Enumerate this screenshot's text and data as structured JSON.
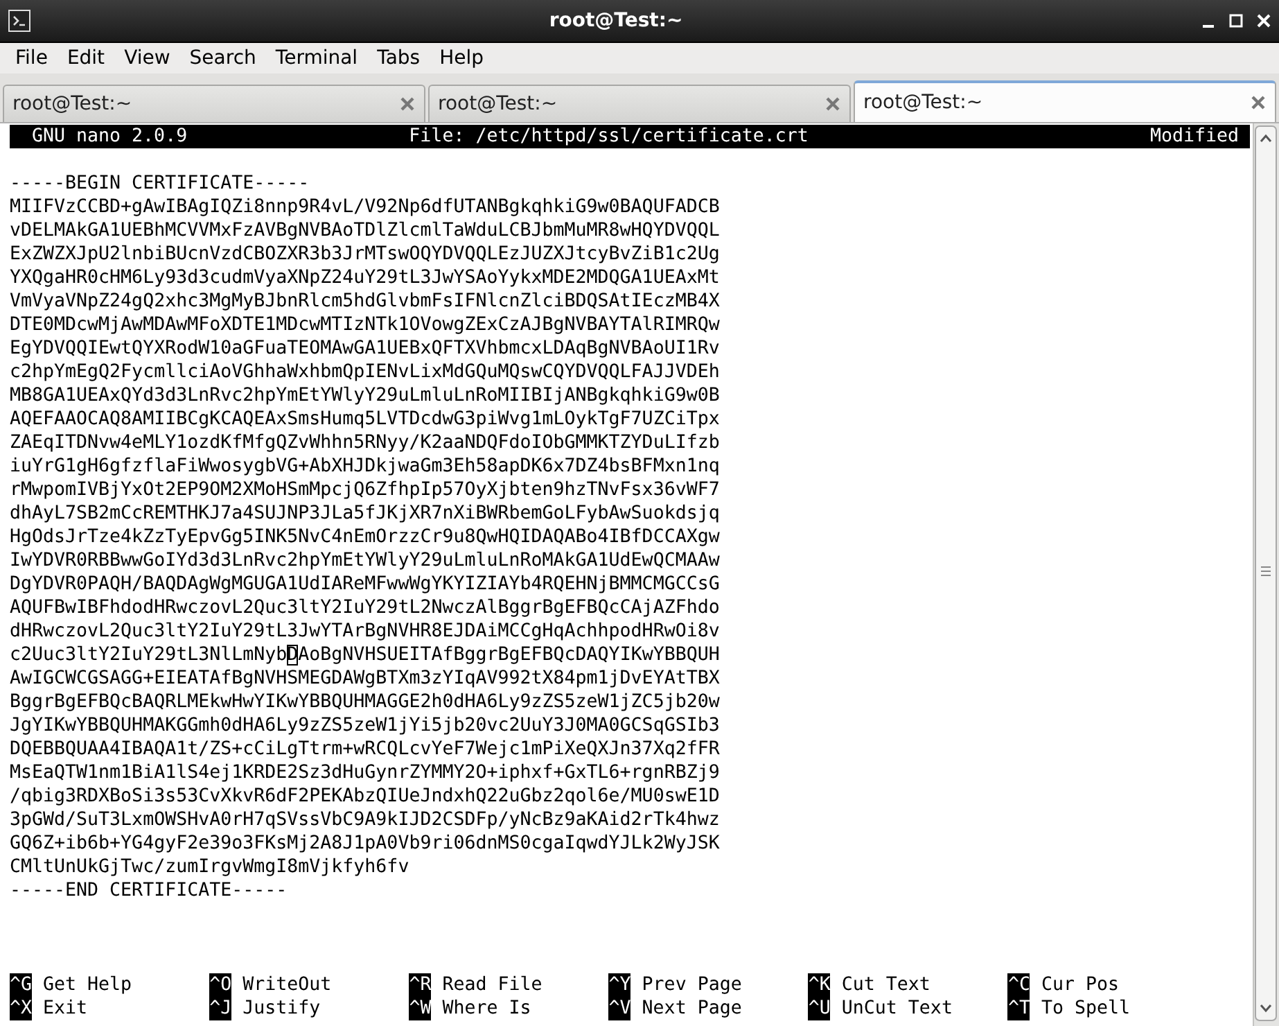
{
  "window": {
    "title": "root@Test:~"
  },
  "menu": [
    "File",
    "Edit",
    "View",
    "Search",
    "Terminal",
    "Tabs",
    "Help"
  ],
  "tabs": [
    {
      "label": "root@Test:~",
      "selected": false
    },
    {
      "label": "root@Test:~",
      "selected": false
    },
    {
      "label": "root@Test:~",
      "selected": true
    }
  ],
  "nano_header": {
    "version": "GNU nano 2.0.9",
    "file": "File: /etc/httpd/ssl/certificate.crt",
    "status": "Modified"
  },
  "editor": {
    "lines": [
      {
        "kind": "plain",
        "text": "-----BEGIN CERTIFICATE-----"
      },
      {
        "kind": "plain",
        "text": "MIIFVzCCBD+gAwIBAgIQZi8nnp9R4vL/V92Np6dfUTANBgkqhkiG9w0BAQUFADCB"
      },
      {
        "kind": "plain",
        "text": "vDELMAkGA1UEBhMCVVMxFzAVBgNVBAoTDlZlcmlTaWduLCBJbmMuMR8wHQYDVQQL"
      },
      {
        "kind": "plain",
        "text": "ExZWZXJpU2lnbiBUcnVzdCBOZXR3b3JrMTswOQYDVQQLEzJUZXJtcyBvZiB1c2Ug"
      },
      {
        "kind": "plain",
        "text": "YXQgaHR0cHM6Ly93d3cudmVyaXNpZ24uY29tL3JwYSAoYykxMDE2MDQGA1UEAxMt"
      },
      {
        "kind": "plain",
        "text": "VmVyaVNpZ24gQ2xhc3MgMyBJbnRlcm5hdGlvbmFsIFNlcnZlciBDQSAtIEczMB4X"
      },
      {
        "kind": "plain",
        "text": "DTE0MDcwMjAwMDAwMFoXDTE1MDcwMTIzNTk1OVowgZExCzAJBgNVBAYTAlRIMRQw"
      },
      {
        "kind": "plain",
        "text": "EgYDVQQIEwtQYXRodW10aGFuaTEOMAwGA1UEBxQFTXVhbmcxLDAqBgNVBAoUI1Rv"
      },
      {
        "kind": "plain",
        "text": "c2hpYmEgQ2FycmllciAoVGhhaWxhbmQpIENvLixMdGQuMQswCQYDVQQLFAJJVDEh"
      },
      {
        "kind": "plain",
        "text": "MB8GA1UEAxQYd3d3LnRvc2hpYmEtYWlyY29uLmluLnRoMIIBIjANBgkqhkiG9w0B"
      },
      {
        "kind": "plain",
        "text": "AQEFAAOCAQ8AMIIBCgKCAQEAxSmsHumq5LVTDcdwG3piWvg1mLOykTgF7UZCiTpx"
      },
      {
        "kind": "plain",
        "text": "ZAEqITDNvw4eMLY1ozdKfMfgQZvWhhn5RNyy/K2aaNDQFdoIObGMMKTZYDuLIfzb"
      },
      {
        "kind": "plain",
        "text": "iuYrG1gH6gfzflaFiWwosygbVG+AbXHJDkjwaGm3Eh58apDK6x7DZ4bsBFMxn1nq"
      },
      {
        "kind": "plain",
        "text": "rMwpomIVBjYxOt2EP9OM2XMoHSmMpcjQ6ZfhpIp57OyXjbten9hzTNvFsx36vWF7"
      },
      {
        "kind": "plain",
        "text": "dhAyL7SB2mCcREMTHKJ7a4SUJNP3JLa5fJKjXR7nXiBWRbemGoLFybAwSuokdsjq"
      },
      {
        "kind": "plain",
        "text": "HgOdsJrTze4kZzTyEpvGg5INK5NvC4nEmOrzzCr9u8QwHQIDAQABo4IBfDCCAXgw"
      },
      {
        "kind": "plain",
        "text": "IwYDVR0RBBwwGoIYd3d3LnRvc2hpYmEtYWlyY29uLmluLnRoMAkGA1UdEwQCMAAw"
      },
      {
        "kind": "plain",
        "text": "DgYDVR0PAQH/BAQDAgWgMGUGA1UdIAReMFwwWgYKYIZIAYb4RQEHNjBMMCMGCCsG"
      },
      {
        "kind": "plain",
        "text": "AQUFBwIBFhdodHRwczovL2Quc3ltY2IuY29tL2NwczAlBggrBgEFBQcCAjAZFhdo"
      },
      {
        "kind": "plain",
        "text": "dHRwczovL2Quc3ltY2IuY29tL3JwYTArBgNVHR8EJDAiMCCgHqAchhpodHRwOi8v"
      },
      {
        "kind": "cursor",
        "before": "c2Uuc3ltY2IuY29tL3NlLmNyb",
        "at_cursor": "D",
        "after": "AoBgNVHSUEITAfBggrBgEFBQcDAQYIKwYBBQUH"
      },
      {
        "kind": "plain",
        "text": "AwIGCWCGSAGG+EIEATAfBgNVHSMEGDAWgBTXm3zYIqAV992tX84pm1jDvEYAtTBX"
      },
      {
        "kind": "plain",
        "text": "BggrBgEFBQcBAQRLMEkwHwYIKwYBBQUHMAGGE2h0dHA6Ly9zZS5zeW1jZC5jb20w"
      },
      {
        "kind": "plain",
        "text": "JgYIKwYBBQUHMAKGGmh0dHA6Ly9zZS5zeW1jYi5jb20vc2UuY3J0MA0GCSqGSIb3"
      },
      {
        "kind": "plain",
        "text": "DQEBBQUAA4IBAQA1t/ZS+cCiLgTtrm+wRCQLcvYeF7Wejc1mPiXeQXJn37Xq2fFR"
      },
      {
        "kind": "plain",
        "text": "MsEaQTW1nm1BiA1lS4ej1KRDE2Sz3dHuGynrZYMMY2O+iphxf+GxTL6+rgnRBZj9"
      },
      {
        "kind": "plain",
        "text": "/qbig3RDXBoSi3s53CvXkvR6dF2PEKAbzQIUeJndxhQ22uGbz2qol6e/MU0swE1D"
      },
      {
        "kind": "plain",
        "text": "3pGWd/SuT3LxmOWSHvA0rH7qSVssVbC9A9kIJD2CSDFp/yNcBz9aKAid2rTk4hwz"
      },
      {
        "kind": "plain",
        "text": "GQ6Z+ib6b+YG4gyF2e39o3FKsMj2A8J1pA0Vb9ri06dnMS0cgaIqwdYJLk2WyJSK"
      },
      {
        "kind": "plain",
        "text": "CMltUnUkGjTwc/zumIrgvWmgI8mVjkfyh6fv"
      },
      {
        "kind": "plain",
        "text": "-----END CERTIFICATE-----"
      }
    ]
  },
  "shortcuts": [
    {
      "key": "^G",
      "label": "Get Help"
    },
    {
      "key": "^O",
      "label": "WriteOut"
    },
    {
      "key": "^R",
      "label": "Read File"
    },
    {
      "key": "^Y",
      "label": "Prev Page"
    },
    {
      "key": "^K",
      "label": "Cut Text"
    },
    {
      "key": "^C",
      "label": "Cur Pos"
    },
    {
      "key": "^X",
      "label": "Exit"
    },
    {
      "key": "^J",
      "label": "Justify"
    },
    {
      "key": "^W",
      "label": "Where Is"
    },
    {
      "key": "^V",
      "label": "Next Page"
    },
    {
      "key": "^U",
      "label": "UnCut Text"
    },
    {
      "key": "^T",
      "label": "To Spell"
    }
  ]
}
